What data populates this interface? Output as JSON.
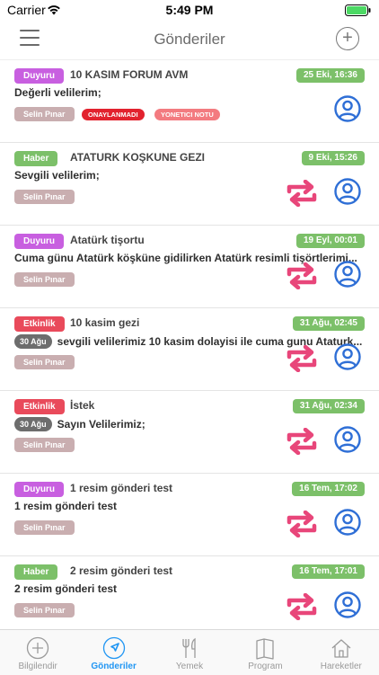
{
  "status_bar": {
    "carrier": "Carrier",
    "time": "5:49 PM"
  },
  "header": {
    "title": "Gönderiler",
    "menu_icon": "hamburger-menu-icon",
    "add_icon": "plus-circle-icon"
  },
  "posts": [
    {
      "type": "Duyuru",
      "type_color": "#c85fe0",
      "title": "10 KASIM FORUM AVM",
      "date": "25 Eki, 16:36",
      "day": "",
      "body": "Değerli velilerim;",
      "author": "Selin Pınar",
      "status_badges": [
        "ONAYLANMADI",
        "YONETICI NOTU"
      ],
      "has_retweet": false
    },
    {
      "type": "Haber",
      "type_color": "#7cc069",
      "title": "ATATURK KOŞKUNE GEZI",
      "date": "9 Eki, 15:26",
      "day": "",
      "body": "Sevgili velilerim;",
      "author": "Selin Pınar",
      "status_badges": [],
      "has_retweet": true
    },
    {
      "type": "Duyuru",
      "type_color": "#c85fe0",
      "title": "Atatürk tişortu",
      "date": "19 Eyl, 00:01",
      "day": "",
      "body": "Cuma günu Atatürk köşküne gidilirken Atatürk resimli tişörtlerimi...",
      "author": "Selin Pınar",
      "status_badges": [],
      "has_retweet": true
    },
    {
      "type": "Etkinlik",
      "type_color": "#e94a5b",
      "title": "10 kasim gezi",
      "date": "31 Ağu, 02:45",
      "day": "30 Ağu",
      "body": "sevgili velilerimiz 10 kasim dolayisi ile cuma gunu Ataturk...",
      "author": "Selin Pınar",
      "status_badges": [],
      "has_retweet": true
    },
    {
      "type": "Etkinlik",
      "type_color": "#e94a5b",
      "title": "İstek",
      "date": "31 Ağu, 02:34",
      "day": "30 Ağu",
      "body": "Sayın Velilerimiz;",
      "author": "Selin Pınar",
      "status_badges": [],
      "has_retweet": true
    },
    {
      "type": "Duyuru",
      "type_color": "#c85fe0",
      "title": "1 resim gönderi test",
      "date": "16 Tem, 17:02",
      "day": "",
      "body": "1 resim gönderi test",
      "author": "Selin Pınar",
      "status_badges": [],
      "has_retweet": true
    },
    {
      "type": "Haber",
      "type_color": "#7cc069",
      "title": "2 resim gönderi test",
      "date": "16 Tem, 17:01",
      "day": "",
      "body": "2 resim gönderi test",
      "author": "Selin Pınar",
      "status_badges": [],
      "has_retweet": true
    }
  ],
  "tabs": [
    {
      "label": "Bilgilendir",
      "icon": "plus-circle-icon",
      "active": false
    },
    {
      "label": "Gönderiler",
      "icon": "navigation-arrow-icon",
      "active": true
    },
    {
      "label": "Yemek",
      "icon": "utensils-icon",
      "active": false
    },
    {
      "label": "Program",
      "icon": "book-icon",
      "active": false
    },
    {
      "label": "Hareketler",
      "icon": "house-icon",
      "active": false
    }
  ],
  "colors": {
    "accent_blue": "#2f6fd6",
    "retweet_pink": "#e8467a",
    "date_green": "#7cc069",
    "active_tab": "#2196f3"
  }
}
